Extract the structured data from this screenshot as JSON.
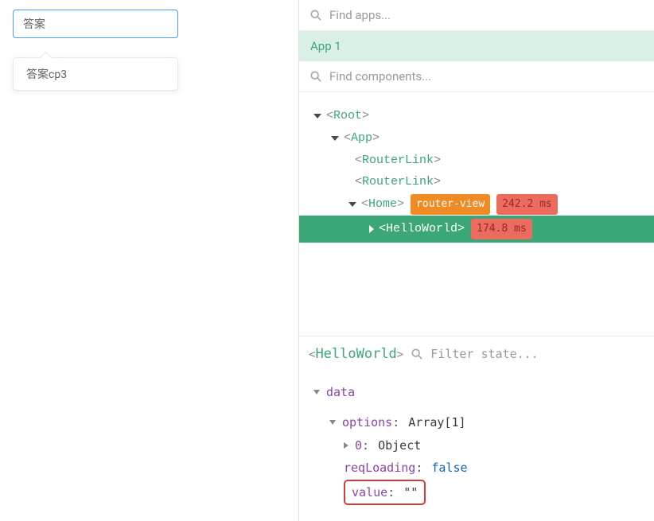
{
  "left": {
    "select_value": "答案",
    "dropdown_item": "答案cp3"
  },
  "devtools": {
    "find_apps_placeholder": "Find apps...",
    "app_label": "App 1",
    "find_components_placeholder": "Find components...",
    "tree": {
      "root": "Root",
      "app": "App",
      "router_link": "RouterLink",
      "home": "Home",
      "home_badge1": "router-view",
      "home_badge2": "242.2 ms",
      "hello_world": "HelloWorld",
      "hello_world_badge": "174.8 ms"
    },
    "state": {
      "component_name": "HelloWorld",
      "filter_placeholder": "Filter state...",
      "data_label": "data",
      "options_key": "options",
      "options_val": "Array[1]",
      "item0_key": "0",
      "item0_val": "Object",
      "reqLoading_key": "reqLoading",
      "reqLoading_val": "false",
      "value_key": "value",
      "value_val": "\"\""
    }
  }
}
